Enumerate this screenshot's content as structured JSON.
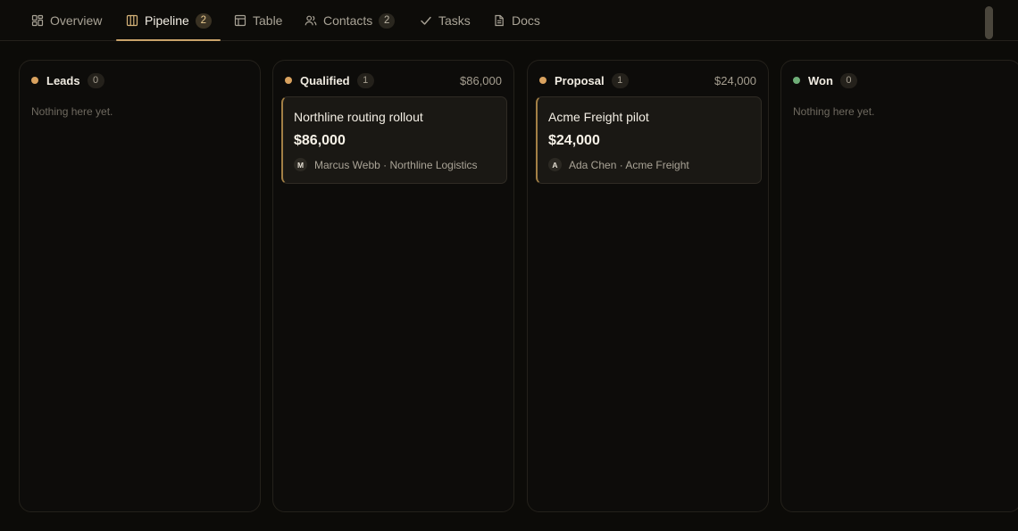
{
  "tabs": [
    {
      "label": "Overview",
      "icon": "dashboard-icon",
      "badge": null
    },
    {
      "label": "Pipeline",
      "icon": "kanban-columns-icon",
      "badge": "2"
    },
    {
      "label": "Table",
      "icon": "table-icon",
      "badge": null
    },
    {
      "label": "Contacts",
      "icon": "users-icon",
      "badge": "2"
    },
    {
      "label": "Tasks",
      "icon": "check-icon",
      "badge": null
    },
    {
      "label": "Docs",
      "icon": "document-icon",
      "badge": null
    }
  ],
  "active_tab": "Pipeline",
  "colors": {
    "accent": "#c9a36a",
    "stage_amber": "#d9a25f",
    "stage_green": "#6fae78",
    "background": "#0c0b08"
  },
  "columns": [
    {
      "title": "Leads",
      "count": "0",
      "total": "",
      "empty_text": "Nothing here yet.",
      "dot_color": "#d9a25f"
    },
    {
      "title": "Qualified",
      "count": "1",
      "total": "$86,000",
      "empty_text": "",
      "dot_color": "#d9a25f",
      "card": {
        "title": "Northline routing rollout",
        "amount": "$86,000",
        "avatar": "M",
        "meta": "Marcus Webb · Northline Logistics"
      }
    },
    {
      "title": "Proposal",
      "count": "1",
      "total": "$24,000",
      "empty_text": "",
      "dot_color": "#d9a25f",
      "card": {
        "title": "Acme Freight pilot",
        "amount": "$24,000",
        "avatar": "A",
        "meta": "Ada Chen · Acme Freight"
      }
    },
    {
      "title": "Won",
      "count": "0",
      "total": "",
      "empty_text": "Nothing here yet.",
      "dot_color": "#6fae78"
    }
  ]
}
